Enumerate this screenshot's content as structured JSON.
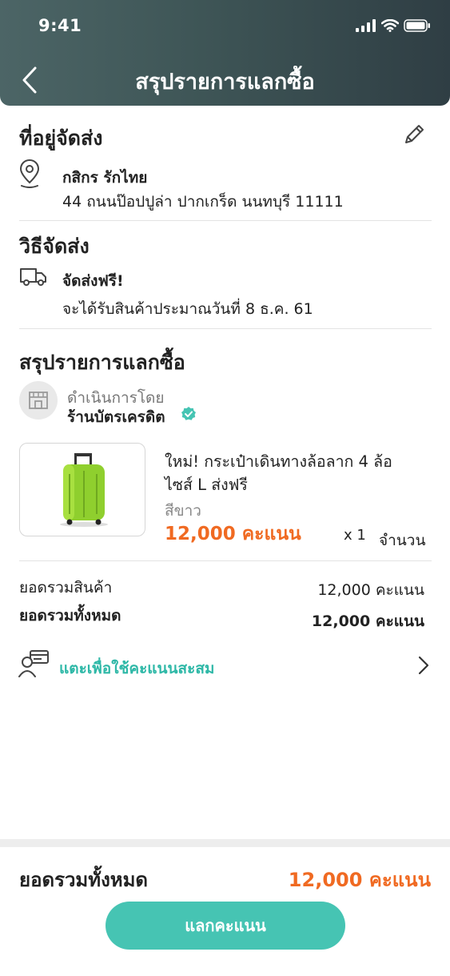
{
  "status_bar": {
    "time": "9:41"
  },
  "header": {
    "title": "สรุปรายการแลกซื้อ"
  },
  "address": {
    "section_title": "ที่อยู่จัดส่ง",
    "name": "กสิกร รักไทย",
    "line": "44 ถนนป๊อปปูล่า ปากเกร็ด นนทบุรี 11111"
  },
  "shipping": {
    "section_title": "วิธีจัดส่ง",
    "method": "จัดส่งฟรี!",
    "eta": "จะได้รับสินค้าประมาณวันที่ 8 ธ.ค. 61"
  },
  "summary": {
    "section_title": "สรุปรายการแลกซื้อ",
    "operated_by_label": "ดำเนินการโดย",
    "store_name": "ร้านบัตรเครดิต"
  },
  "product": {
    "name_line1": "ใหม่! กระเป๋าเดินทางล้อลาก 4 ล้อ",
    "name_line2": "ไซส์ L  ส่งฟรี",
    "variant": "สีขาว",
    "price": "12,000 คะแนน",
    "quantity": "x 1",
    "quantity_label": "จำนวน"
  },
  "totals": {
    "subtotal_label": "ยอดรวมสินค้า",
    "subtotal_value": "12,000 คะแนน",
    "total_label": "ยอดรวมทั้งหมด",
    "total_value": "12,000 คะแนน"
  },
  "redeem_points_link": {
    "label": "แตะเพื่อใช้คะแนนสะสม"
  },
  "footer": {
    "total_label": "ยอดรวมทั้งหมด",
    "total_value": "12,000 คะแนน",
    "button_label": "แลกคะแนน"
  },
  "colors": {
    "accent_orange": "#f06a22",
    "accent_teal": "#46c4b3",
    "header_dark": "#2f3e44"
  },
  "icons": [
    "back-icon",
    "signal-icon",
    "wifi-icon",
    "battery-icon",
    "edit-icon",
    "location-pin-icon",
    "truck-icon",
    "store-icon",
    "verified-icon",
    "luggage-image",
    "card-user-icon",
    "chevron-right-icon"
  ]
}
